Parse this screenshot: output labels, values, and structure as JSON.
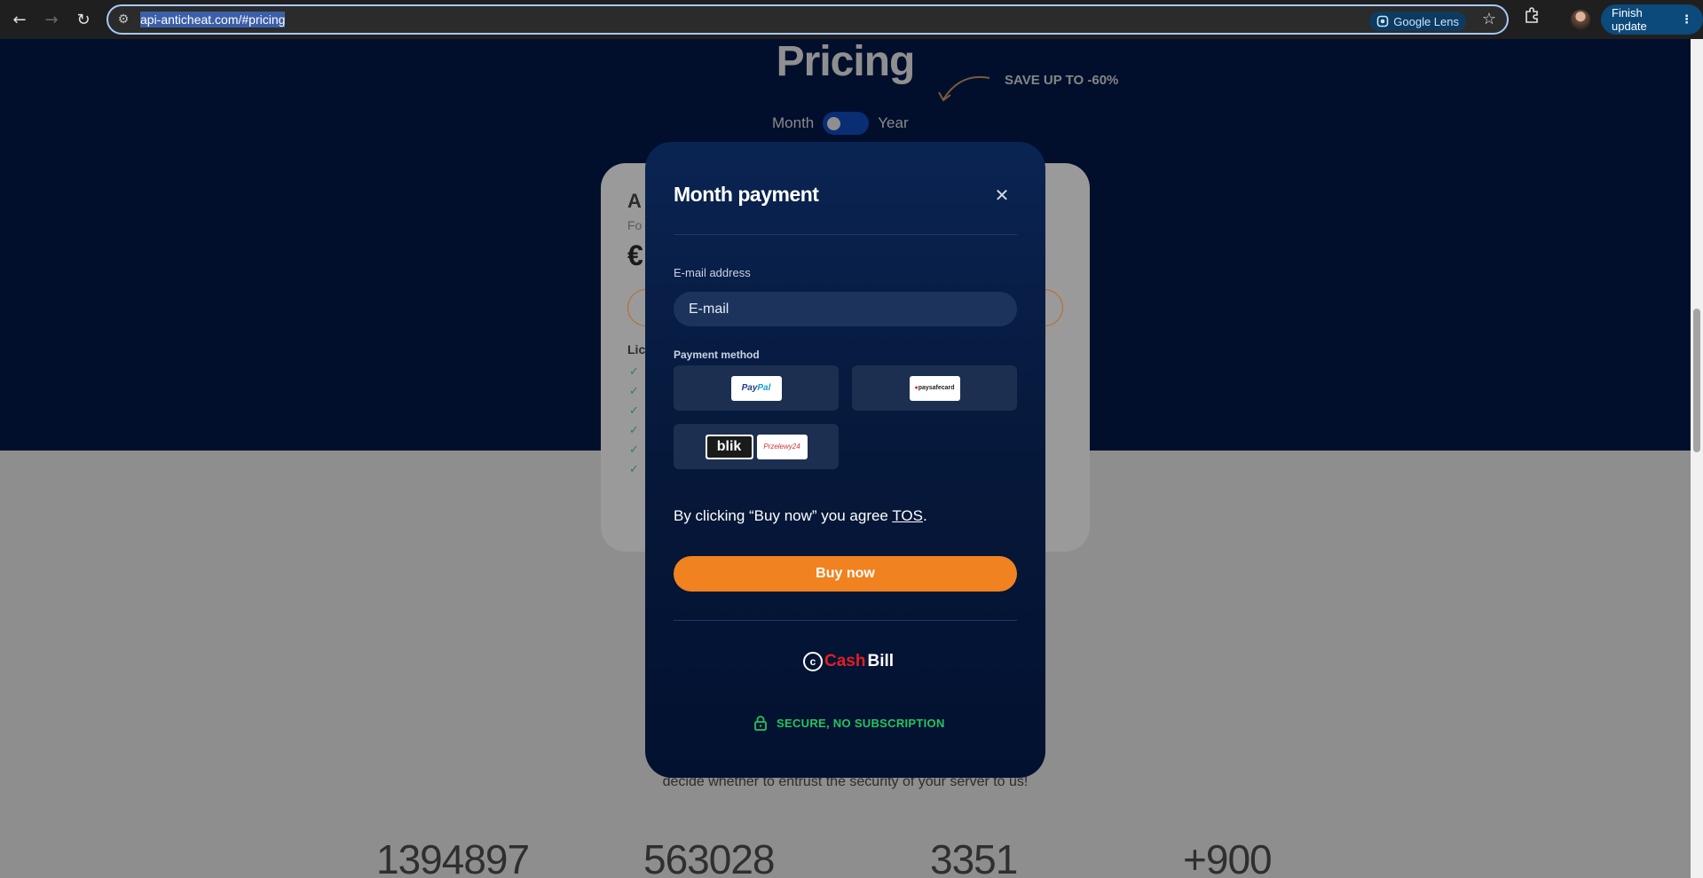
{
  "browser": {
    "back_icon": "←",
    "forward_icon": "→",
    "reload_icon": "↻",
    "url_display": "api-anticheat.com/#pricing",
    "lens_label": "Google Lens",
    "star_icon": "☆",
    "update_label": "Finish update",
    "menu_icon": "⋮"
  },
  "background": {
    "pricing_title": "Pricing",
    "save_label": "SAVE UP TO -60%",
    "toggle_month": "Month",
    "toggle_year": "Year",
    "card_title": "A",
    "card_subtitle": "Fo",
    "card_price": "€",
    "card_list_heading": "Lic",
    "bottom_text": "decide whether to entrust the security of your server to us!",
    "stats": [
      "1394897",
      "563028",
      "3351",
      "+900"
    ]
  },
  "modal": {
    "title": "Month payment",
    "close_icon": "✕",
    "email_label": "E-mail address",
    "email_placeholder": "E-mail",
    "email_value": "",
    "payment_method_label": "Payment method",
    "methods": {
      "paypal": {
        "p1": "Pay",
        "p2": "Pal"
      },
      "paysafecard": {
        "dot": "●",
        "name": "paysafecard"
      },
      "blik": "blik",
      "przelewy24": "Przelewy24"
    },
    "tos_prefix": "By clicking “Buy now” you agree ",
    "tos_link": "TOS",
    "tos_suffix": ".",
    "buy_label": "Buy now",
    "provider": {
      "icon": "c",
      "cash": "Cash",
      "bill": "Bill"
    },
    "secure_text": "SECURE, NO SUBSCRIPTION"
  },
  "colors": {
    "accent_orange": "#f08220",
    "modal_bg": "#06183a",
    "secure_green": "#22c55e",
    "hero_bg": "#010f2c"
  }
}
